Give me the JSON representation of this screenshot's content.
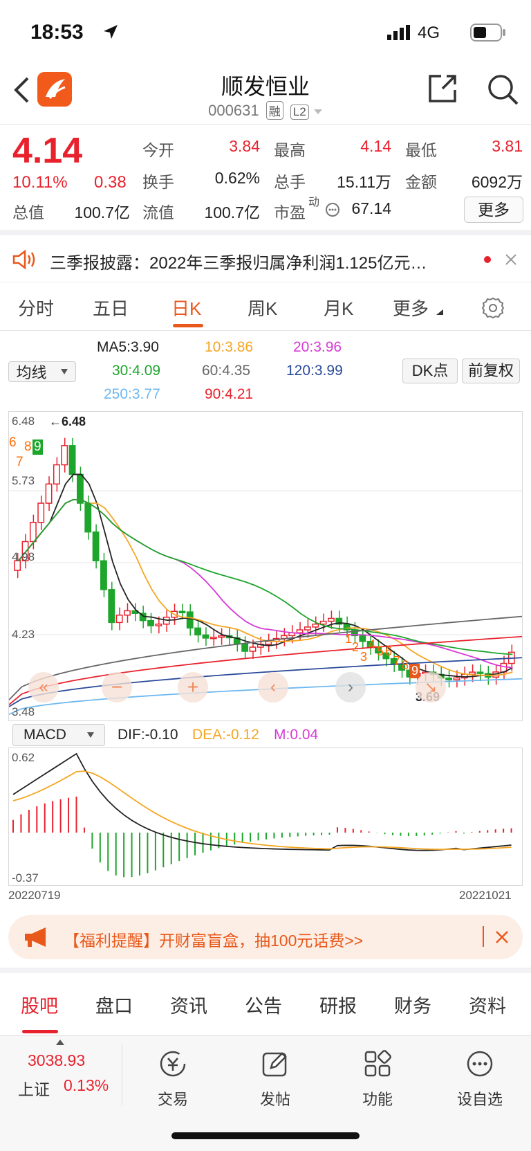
{
  "status_bar": {
    "time": "18:53",
    "network": "4G"
  },
  "header": {
    "title": "顺发恒业",
    "code": "000631",
    "tag_rong": "融",
    "tag_l2": "L2"
  },
  "quote": {
    "price": "4.14",
    "pct": "10.11%",
    "change": "0.38",
    "fields": [
      {
        "label": "今开",
        "value": "3.84",
        "red": true
      },
      {
        "label": "最高",
        "value": "4.14",
        "red": true
      },
      {
        "label": "最低",
        "value": "3.81",
        "red": true
      },
      {
        "label": "换手",
        "value": "0.62%",
        "red": false
      },
      {
        "label": "总手",
        "value": "15.11万",
        "red": false
      },
      {
        "label": "金额",
        "value": "6092万",
        "red": false
      },
      {
        "label": "总值",
        "value": "100.7亿",
        "red": false
      },
      {
        "label": "流值",
        "value": "100.7亿",
        "red": false
      },
      {
        "label": "市盈",
        "value": "67.14",
        "red": false
      }
    ],
    "pe_sup": "动",
    "more_label": "更多"
  },
  "news": {
    "text": "三季报披露：2022年三季报归属净利润1.125亿元…"
  },
  "tabs": [
    "分时",
    "五日",
    "日K",
    "周K",
    "月K",
    "更多"
  ],
  "active_tab": "日K",
  "ma_legend": {
    "selector": "均线",
    "items": [
      {
        "text": "MA5:3.90",
        "color": "#222222"
      },
      {
        "text": "10:3.86",
        "color": "#f5a623"
      },
      {
        "text": "20:3.96",
        "color": "#d63bd6"
      },
      {
        "text": "30:4.09",
        "color": "#1ea52c"
      },
      {
        "text": "60:4.35",
        "color": "#666666"
      },
      {
        "text": "120:3.99",
        "color": "#2a4a9a"
      },
      {
        "text": "250:3.77",
        "color": "#6db8f0"
      },
      {
        "text": "90:4.21",
        "color": "#e8222d"
      }
    ],
    "dk_button": "DK点",
    "fq_button": "前复权"
  },
  "kline": {
    "y_ticks": [
      "6.48",
      "5.73",
      "4.98",
      "4.23",
      "3.48"
    ],
    "high_label": "←6.48",
    "low_label": "3.69",
    "seq_up": [
      "6",
      "7",
      "8",
      "9"
    ],
    "seq_down": [
      "1",
      "2",
      "3",
      "4",
      "5",
      "6",
      "7",
      "8",
      "9"
    ]
  },
  "macd": {
    "selector": "MACD",
    "dif": "DIF:-0.10",
    "dea": "DEA:-0.12",
    "m": "M:0.04",
    "y_top": "0.62",
    "y_bottom": "-0.37",
    "date_start": "20220719",
    "date_end": "20221021"
  },
  "chart_data": {
    "type": "candlestick",
    "title": "",
    "x_range": [
      "20220719",
      "20221021"
    ],
    "ylim": [
      3.48,
      6.48
    ],
    "moving_averages": {
      "MA5": 3.9,
      "MA10": 3.86,
      "MA20": 3.96,
      "MA30": 4.09,
      "MA60": 4.35,
      "MA90": 4.21,
      "MA120": 3.99,
      "MA250": 3.77
    },
    "high": 6.48,
    "low": 3.69,
    "last": 4.14,
    "macd": {
      "DIF": -0.1,
      "DEA": -0.12,
      "M": 0.04,
      "ylim": [
        -0.37,
        0.62
      ]
    }
  },
  "promo": {
    "text": "【福利提醒】开财富盲盒，抽100元话费>>"
  },
  "bottom_tabs": [
    "股吧",
    "盘口",
    "资讯",
    "公告",
    "研报",
    "财务",
    "资料"
  ],
  "dock": {
    "index_value": "3038.93",
    "index_name": "上证",
    "index_pct": "0.13%",
    "items": [
      "交易",
      "发帖",
      "功能",
      "设自选"
    ]
  }
}
